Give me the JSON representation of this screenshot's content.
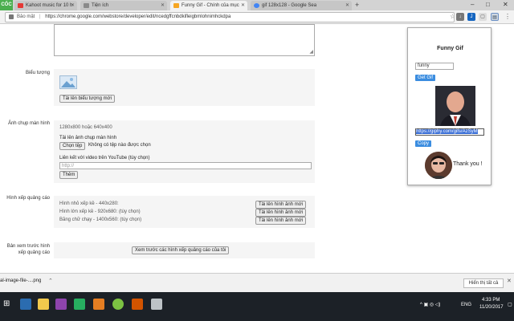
{
  "browser": {
    "brand_badge": "CỐC",
    "tabs": [
      {
        "label": "Kahoot music for 10 h",
        "fav_color": "#e53935"
      },
      {
        "label": "Tiện ích",
        "fav_color": "#8a8a8a"
      },
      {
        "label": "Funny Gif - Chính của mục",
        "fav_color": "#f6a623"
      },
      {
        "label": "gif 128x128 - Google Sea",
        "fav_color": "#4285f4"
      }
    ],
    "newtab_glyph": "+",
    "window_controls": [
      "–",
      "□",
      "✕"
    ],
    "security_label": "Bảo mật",
    "url": "https://chrome.google.com/webstore/developer/edit/ncedgffcnbdkifleigbmlohnimhckdpa"
  },
  "page": {
    "icon_section": {
      "label": "Biểu tượng",
      "upload_button": "Tải lên biểu tượng mới"
    },
    "screenshot_section": {
      "label": "Ảnh chụp màn hình",
      "size_hint": "1280x800 hoặc 640x400",
      "upload_title": "Tải lên ảnh chụp màn hình",
      "choose_file_button": "Chọn tệp",
      "no_file_text": "Không có tệp nào được chọn",
      "youtube_label": "Liên kết với video trên YouTube (tùy chọn)",
      "url_placeholder": "http://",
      "add_button": "Thêm"
    },
    "promo_section": {
      "label": "Hình xếp quảng cáo",
      "rows": [
        {
          "text": "Hình nhỏ xếp kề - 440x280:",
          "button": "Tải lên hình ảnh mới"
        },
        {
          "text": "Hình lớn xếp kề - 920x680: (tùy chọn)",
          "button": "Tải lên hình ảnh mới"
        },
        {
          "text": "Băng chữ chạy - 1400x560: (tùy chọn)",
          "button": "Tải lên hình ảnh mới"
        }
      ]
    },
    "preview_section": {
      "label": "Bản xem trước hình xếp quảng cáo",
      "button": "Xem trước các hình xếp quảng cáo của tôi"
    }
  },
  "popup": {
    "title": "Funny Gif",
    "search_value": "funny",
    "get_button": "Get Gif",
    "link_value": "https://giphy.com/gifs/AzSyM",
    "copy_button": "Copy",
    "thank_text": "Thank you !"
  },
  "download_bar": {
    "file_name": "al-image-file-....png",
    "show_all": "Hiển thị tất cả"
  },
  "taskbar": {
    "language": "ENG",
    "time": "4:33 PM",
    "date": "11/20/2017"
  }
}
